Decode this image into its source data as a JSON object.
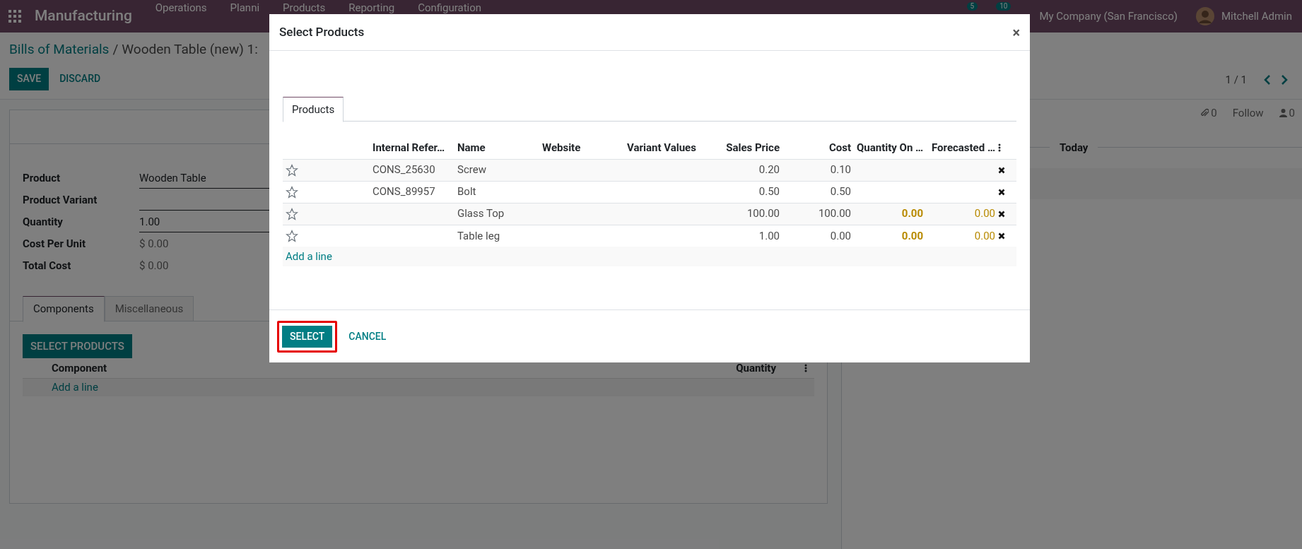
{
  "top_bar": {
    "app_name": "Manufacturing",
    "menu": [
      "Operations",
      "Planni",
      "Products",
      "Reporting",
      "Configuration"
    ],
    "badges": [
      {
        "count": "5"
      },
      {
        "count": "10"
      }
    ],
    "company": "My Company (San Francisco)",
    "user": "Mitchell Admin"
  },
  "breadcrumb": {
    "parent": "Bills of Materials",
    "separator": "/",
    "current": "Wooden Table (new) 1:"
  },
  "actions": [
    "SAVE",
    "DISCARD"
  ],
  "pager": "1 / 1",
  "form": {
    "fields": [
      {
        "label": "Product",
        "value": "Wooden Table",
        "kind": "input"
      },
      {
        "label": "Product Variant",
        "kind": "input"
      },
      {
        "label": "Quantity",
        "value": "1.00",
        "kind": "input"
      },
      {
        "label": "Cost Per Unit",
        "value": "$ 0.00",
        "kind": "readonly"
      },
      {
        "label": "Total Cost",
        "value": "$ 0.00",
        "kind": "readonly"
      }
    ],
    "tabs": [
      {
        "label": "Components",
        "selected": true
      },
      {
        "label": "Miscellaneous",
        "selected": false
      }
    ],
    "select_button": "SELECT PRODUCTS",
    "columns": [
      "Component",
      "Quantity"
    ],
    "add_line": "Add a line"
  },
  "chatter": {
    "attachments": "0",
    "follow": "Follow",
    "followers": "0",
    "divider": "Today"
  },
  "dialog": {
    "title": "Select Products",
    "close": "×",
    "tabs": [
      {
        "label": "Products",
        "selected": true
      }
    ],
    "columns": [
      "Internal Refer…",
      "Name",
      "Website",
      "Variant Values",
      "Sales Price",
      "Cost",
      "Quantity On …",
      "Forecasted …"
    ],
    "rows": [
      {
        "favorite": false,
        "internal_ref": "CONS_25630",
        "name": "Screw",
        "sales_price": "0.20",
        "cost": "0.10"
      },
      {
        "favorite": false,
        "internal_ref": "CONS_89957",
        "name": "Bolt",
        "sales_price": "0.50",
        "cost": "0.50"
      },
      {
        "favorite": false,
        "name": "Glass Top",
        "sales_price": "100.00",
        "cost": "100.00",
        "qty_on_hand": "0.00",
        "forecasted": "0.00"
      },
      {
        "favorite": false,
        "name": "Table leg",
        "sales_price": "1.00",
        "cost": "0.00",
        "qty_on_hand": "0.00",
        "forecasted": "0.00"
      }
    ],
    "add_line": "Add a line",
    "buttons": [
      {
        "label": "SELECT",
        "kind": "primary",
        "highlighted": true
      },
      {
        "label": "CANCEL",
        "kind": "link",
        "highlighted": false
      }
    ]
  }
}
